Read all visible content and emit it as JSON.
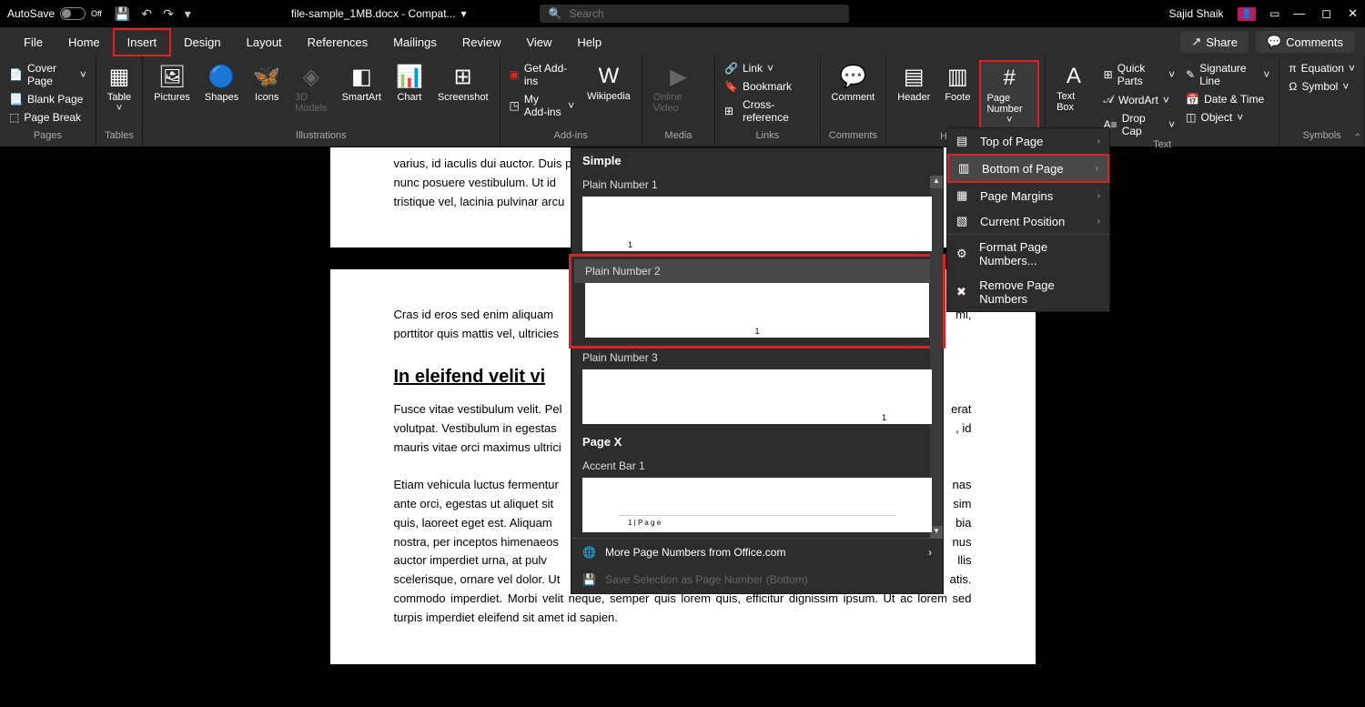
{
  "titlebar": {
    "autosave_label": "AutoSave",
    "autosave_state": "Off",
    "filename": "file-sample_1MB.docx  -  Compat...",
    "search_placeholder": "Search",
    "username": "Sajid Shaik"
  },
  "tabs": {
    "file": "File",
    "home": "Home",
    "insert": "Insert",
    "design": "Design",
    "layout": "Layout",
    "references": "References",
    "mailings": "Mailings",
    "review": "Review",
    "view": "View",
    "help": "Help",
    "share": "Share",
    "comments": "Comments"
  },
  "ribbon": {
    "pages": {
      "label": "Pages",
      "cover": "Cover Page",
      "blank": "Blank Page",
      "break": "Page Break"
    },
    "tables": {
      "label": "Tables",
      "table": "Table"
    },
    "illustrations": {
      "label": "Illustrations",
      "pictures": "Pictures",
      "shapes": "Shapes",
      "icons": "Icons",
      "models": "3D Models",
      "smartart": "SmartArt",
      "chart": "Chart",
      "screenshot": "Screenshot"
    },
    "addins": {
      "label": "Add-ins",
      "get": "Get Add-ins",
      "my": "My Add-ins",
      "wikipedia": "Wikipedia"
    },
    "media": {
      "label": "Media",
      "video": "Online Video"
    },
    "links": {
      "label": "Links",
      "link": "Link",
      "bookmark": "Bookmark",
      "xref": "Cross-reference"
    },
    "comments": {
      "label": "Comments",
      "comment": "Comment"
    },
    "headerfooter": {
      "label": "Header & F",
      "header": "Header",
      "footer": "Foote",
      "pagenum": "Page Number"
    },
    "text": {
      "label": "Text",
      "textbox": "Text Box",
      "quickparts": "Quick Parts",
      "wordart": "WordArt",
      "dropcap": "Drop Cap",
      "sigline": "Signature Line",
      "datetime": "Date & Time",
      "object": "Object"
    },
    "symbols": {
      "label": "Symbols",
      "equation": "Equation",
      "symbol": "Symbol"
    }
  },
  "submenu": {
    "top": "Top of Page",
    "bottom": "Bottom of Page",
    "margins": "Page Margins",
    "current": "Current Position",
    "format": "Format Page Numbers...",
    "remove": "Remove Page Numbers"
  },
  "gallery": {
    "simple": "Simple",
    "plain1": "Plain Number 1",
    "plain2": "Plain Number 2",
    "plain3": "Plain Number 3",
    "pagex": "Page X",
    "accent1": "Accent Bar 1",
    "accent_text": "1 | P a g e",
    "more": "More Page Numbers from Office.com",
    "save": "Save Selection as Page Number (Bottom)"
  },
  "document": {
    "para1": "varius, id iaculis dui auctor. Duis p",
    "para1b": "nunc posuere vestibulum. Ut id",
    "para1c": "tristique vel, lacinia pulvinar arcu",
    "para2a": "Cras id eros sed enim aliquam",
    "para2b": "porttitor quis mattis vel, ultricies",
    "para2end": "mi,",
    "heading": "In eleifend velit vi",
    "para3a": "Fusce vitae vestibulum velit. Pel",
    "para3b": "volutpat. Vestibulum in egestas",
    "para3c": "mauris vitae orci maximus ultrici",
    "para3end1": "erat",
    "para3end2": ", id",
    "para4a": "Etiam vehicula luctus fermentur",
    "para4b": "ante orci, egestas ut aliquet sit",
    "para4c": "quis, laoreet eget est. Aliquam",
    "para4d": "nostra, per inceptos himenaeos",
    "para4e": "auctor imperdiet urna, at pulv",
    "para4f": "scelerisque, ornare vel dolor. Ut",
    "para4end": [
      "nas",
      "sim",
      "bia",
      "nus",
      "llis",
      "atis."
    ],
    "para5": "commodo imperdiet. Morbi velit neque, semper quis lorem quis, efficitur dignissim ipsum. Ut ac lorem sed turpis imperdiet eleifend sit amet id sapien."
  }
}
